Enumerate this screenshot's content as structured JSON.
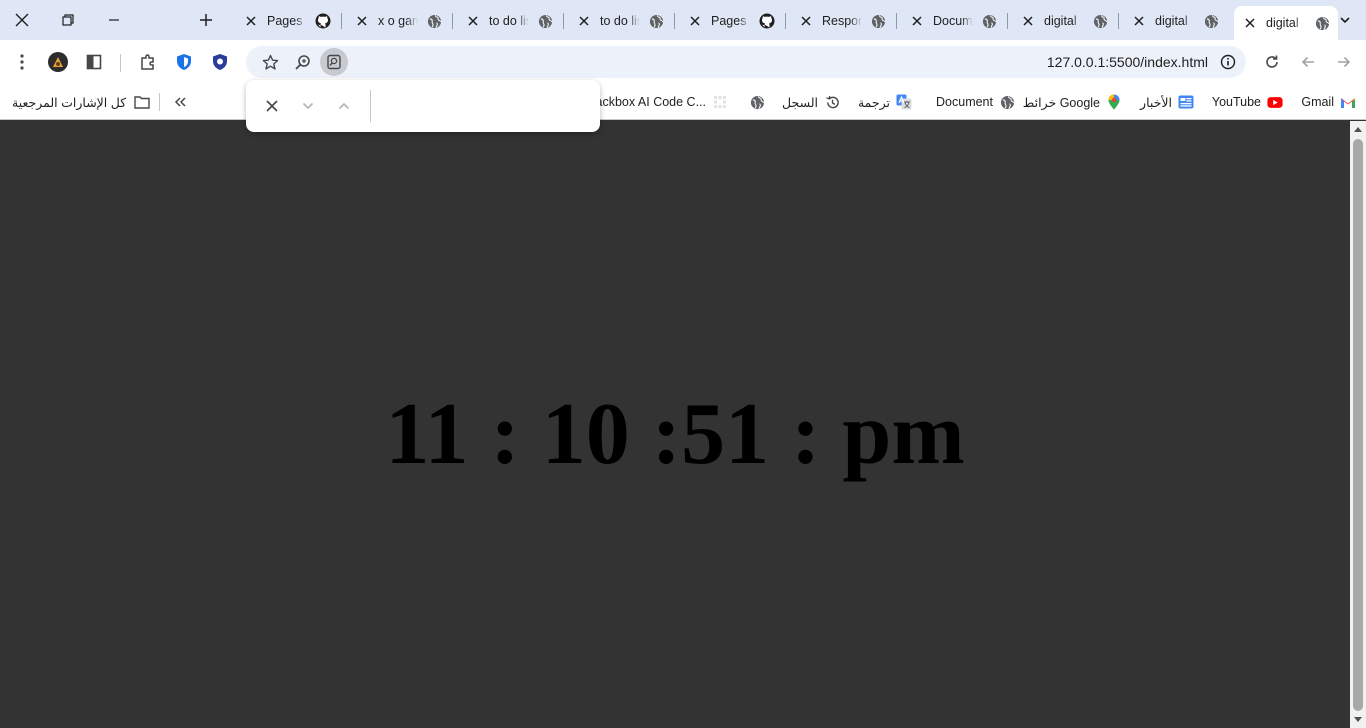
{
  "tabs": [
    {
      "title": "digital",
      "icon": "globe-icon",
      "active": true
    },
    {
      "title": "digital",
      "icon": "globe-icon",
      "active": false
    },
    {
      "title": "digital",
      "icon": "globe-icon",
      "active": false
    },
    {
      "title": "Document",
      "icon": "globe-icon",
      "active": false
    },
    {
      "title": "Responsive",
      "icon": "globe-icon",
      "active": false
    },
    {
      "title": "Pages",
      "icon": "github-icon",
      "active": false
    },
    {
      "title": "to do list",
      "icon": "globe-icon",
      "active": false
    },
    {
      "title": "to do list",
      "icon": "globe-icon",
      "active": false
    },
    {
      "title": "x o game",
      "icon": "globe-icon",
      "active": false
    },
    {
      "title": "Pages",
      "icon": "github-icon",
      "active": false
    }
  ],
  "address_bar": {
    "url": "127.0.0.1:5500/index.html"
  },
  "find_bar": {
    "query": ""
  },
  "bookmarks": [
    {
      "label": "Gmail",
      "icon": "gmail-icon"
    },
    {
      "label": "YouTube",
      "icon": "youtube-icon"
    },
    {
      "label": "الأخبار",
      "icon": "news-icon"
    },
    {
      "label": "خرائط Google",
      "icon": "maps-pin-icon"
    },
    {
      "label": "Document",
      "icon": "globe-icon"
    },
    {
      "label": "ترجمة",
      "icon": "translate-icon"
    },
    {
      "label": "السجل",
      "icon": "history-icon"
    },
    {
      "label": "",
      "icon": "globe-icon"
    },
    {
      "label": "Blackbox AI Code C...",
      "icon": "blackbox-icon"
    }
  ],
  "all_bookmarks_label": "كل الإشارات المرجعية",
  "clock": {
    "display": "11 : 10 :51 : pm"
  },
  "colors": {
    "tabstrip_bg": "#dfe6f5",
    "page_bg": "#333333",
    "clock_text": "#000000"
  }
}
